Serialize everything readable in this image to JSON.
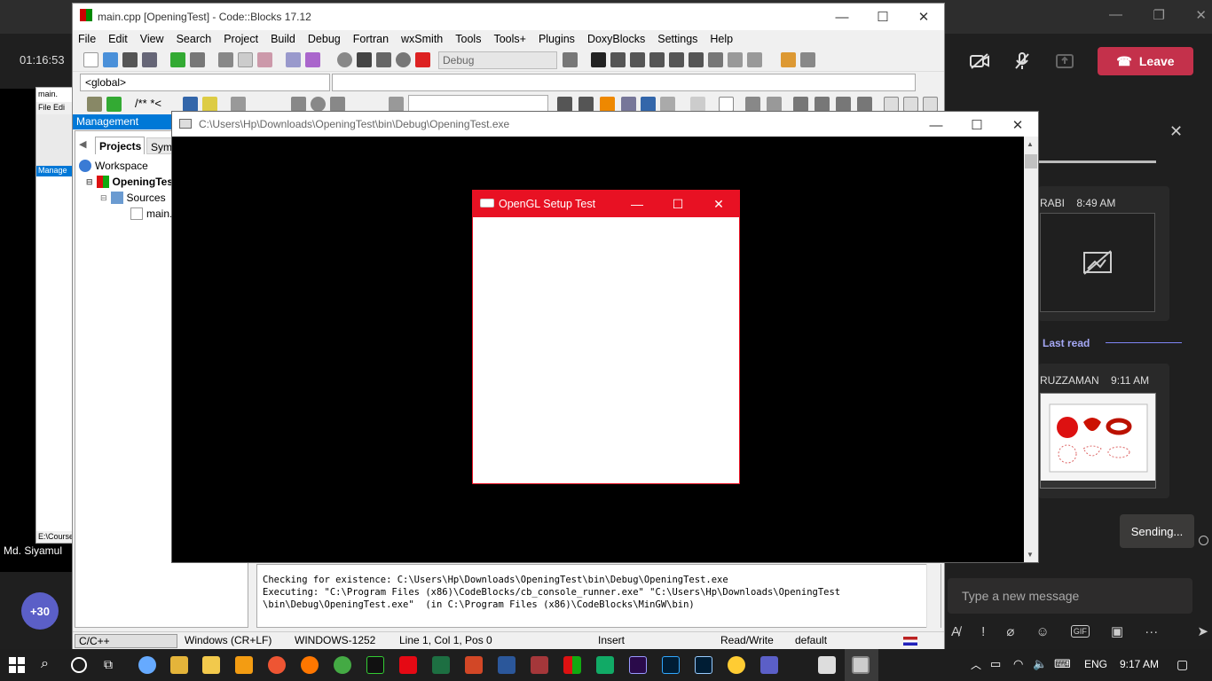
{
  "teams": {
    "timer": "01:16:53",
    "leave_label": "Leave",
    "participant_name": "Md. Siyamul",
    "more_participants": "+30",
    "chat": {
      "msg1_name": "RABI",
      "msg1_time": "8:49 AM",
      "last_read": "Last read",
      "msg2_name": "RUZZAMAN",
      "msg2_time": "9:11 AM",
      "sending": "Sending...",
      "input_placeholder": "Type a new message"
    }
  },
  "codeblocks": {
    "title": "main.cpp [OpeningTest] - Code::Blocks 17.12",
    "menu": [
      "File",
      "Edit",
      "View",
      "Search",
      "Project",
      "Build",
      "Debug",
      "Fortran",
      "wxSmith",
      "Tools",
      "Tools+",
      "Plugins",
      "DoxyBlocks",
      "Settings",
      "Help"
    ],
    "build_target": "Debug",
    "scope_select": "<global>",
    "comment_buttons": "/** *<",
    "management": {
      "header": "Management",
      "tab_projects": "Projects",
      "tab_symbols": "Symbols",
      "tree": {
        "workspace": "Workspace",
        "project": "OpeningTest",
        "sources": "Sources",
        "file": "main.cpp"
      }
    },
    "log_lines": [
      "Checking for existence: C:\\Users\\Hp\\Downloads\\OpeningTest\\bin\\Debug\\OpeningTest.exe",
      "Executing: \"C:\\Program Files (x86)\\CodeBlocks/cb_console_runner.exe\" \"C:\\Users\\Hp\\Downloads\\OpeningTest",
      "\\bin\\Debug\\OpeningTest.exe\"  (in C:\\Program Files (x86)\\CodeBlocks\\MinGW\\bin)"
    ],
    "status": {
      "language": "C/C++",
      "line_endings": "Windows (CR+LF)",
      "encoding": "WINDOWS-1252",
      "position": "Line 1, Col 1, Pos 0",
      "mode": "Insert",
      "access": "Read/Write",
      "profile": "default"
    },
    "small_copy": {
      "title": "main.",
      "path": "E:\\Course"
    }
  },
  "console": {
    "title": "C:\\Users\\Hp\\Downloads\\OpeningTest\\bin\\Debug\\OpeningTest.exe"
  },
  "opengl": {
    "title": "OpenGL Setup Test"
  },
  "taskbar": {
    "language": "ENG",
    "time": "9:17 AM"
  }
}
